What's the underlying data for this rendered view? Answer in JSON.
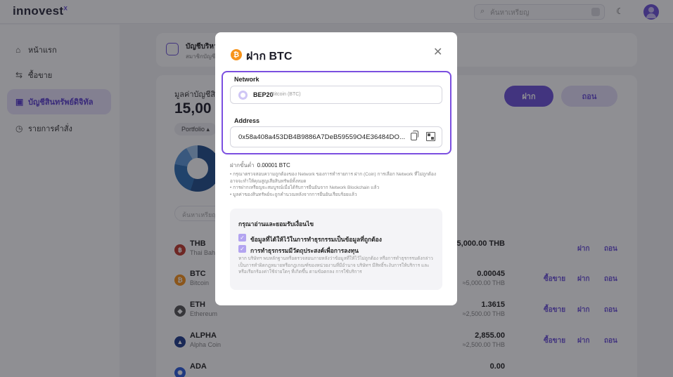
{
  "header": {
    "logo": "innovest",
    "logo_mark": "x",
    "search_placeholder": "ค้นหาเหรียญ"
  },
  "sidebar": {
    "items": [
      {
        "label": "หน้าแรก",
        "icon": "home-icon"
      },
      {
        "label": "ซื้อขาย",
        "icon": "swap-icon"
      },
      {
        "label": "บัญชีสินทรัพย์ดิจิทัล",
        "icon": "wallet-icon",
        "active": true
      },
      {
        "label": "รายการคำสั่ง",
        "icon": "clock-icon"
      }
    ]
  },
  "account": {
    "title": "บัญชีบริหา",
    "subtitle": "สมาชิกบัญชี"
  },
  "portfolio": {
    "label": "มูลค่าบัญชีสิ",
    "value": "15,00",
    "deposit_label": "ฝาก",
    "withdraw_label": "ถอน",
    "select_label": "Portfolio",
    "search_placeholder": "ค้นหาเหรียญ"
  },
  "assets": [
    {
      "symbol": "THB",
      "name": "Thai Baht",
      "amount": "5,000.00 THB",
      "thb": "",
      "actions": [
        "",
        "ฝาก",
        "ถอน"
      ],
      "coin_color": "#c0392b",
      "coin_glyph": "฿"
    },
    {
      "symbol": "BTC",
      "name": "Bitcoin",
      "amount": "0.00045",
      "thb": "≈5,000.00 THB",
      "actions": [
        "ซื้อขาย",
        "ฝาก",
        "ถอน"
      ],
      "coin_color": "#f7931a",
      "coin_glyph": "₿"
    },
    {
      "symbol": "ETH",
      "name": "Ethereum",
      "amount": "1.3615",
      "thb": "≈2,500.00 THB",
      "actions": [
        "ซื้อขาย",
        "ฝาก",
        "ถอน"
      ],
      "coin_color": "#555555",
      "coin_glyph": "◆"
    },
    {
      "symbol": "ALPHA",
      "name": "Alpha Coin",
      "amount": "2,855.00",
      "thb": "≈2,500.00 THB",
      "actions": [
        "ซื้อขาย",
        "ฝาก",
        "ถอน"
      ],
      "coin_color": "#1e3a8a",
      "coin_glyph": "▲"
    },
    {
      "symbol": "ADA",
      "name": "",
      "amount": "0.00",
      "thb": "",
      "actions": [
        "",
        "",
        ""
      ],
      "coin_color": "#2a5ada",
      "coin_glyph": "✺"
    }
  ],
  "modal": {
    "title": "ฝาก BTC",
    "network_label": "Network",
    "network_name": "BEP20",
    "network_sub": "Bitcoin (BTC)",
    "address_label": "Address",
    "address_value": "0x58a408a453DB4B9886A7DeB59559O4E36484DO...",
    "min_deposit_label": "ฝากขั้นต่ำ",
    "min_deposit_value": "0.00001 BTC",
    "notes": [
      "กรุณาตรวจสอบความถูกต้องของ Network ของการทำรายการ ฝาก (Coin) การเลือก Network ที่ไม่ถูกต้อง อาจจะทำให้คุณสูญเสียสินทรัพย์ทั้งหมด",
      "การฝากเหรียญจะสมบูรณ์เมื่อได้รับการยืนยันจาก Network Blockchain แล้ว",
      "มูลค่าของสินทรัพย์จะถูกคำนวณหลังจากการยืนยันเรียบร้อยแล้ว"
    ],
    "consent_title": "กรุณาอ่านและยอมรับเงื่อนไข",
    "check1": "ข้อมูลที่ได้ให้ไว้ในการทำธุรกรรมเป็นข้อมูลที่ถูกต้อง",
    "check2": "การทำธุรกรรมมีวัตถุประสงค์เพื่อการลงทุน",
    "consent_body": "หาก บริษัทฯ พบหลักฐานหรือตรวจสอบภายหลังว่าข้อมูลที่ให้ไว้ไม่ถูกต้อง หรือการทำธุรกรรมดังกล่าวเป็นการทำผิดกฎหมายหรือกฎเกณฑ์ของหน่วยงานที่มีอำนาจ บริษัทฯ มีสิทธิ์ระงับการให้บริการ และหรือเรียกร้องค่าใช้จ่ายใดๆ ที่เกิดขึ้น ตามข้อตกลง การใช้บริการ"
  }
}
